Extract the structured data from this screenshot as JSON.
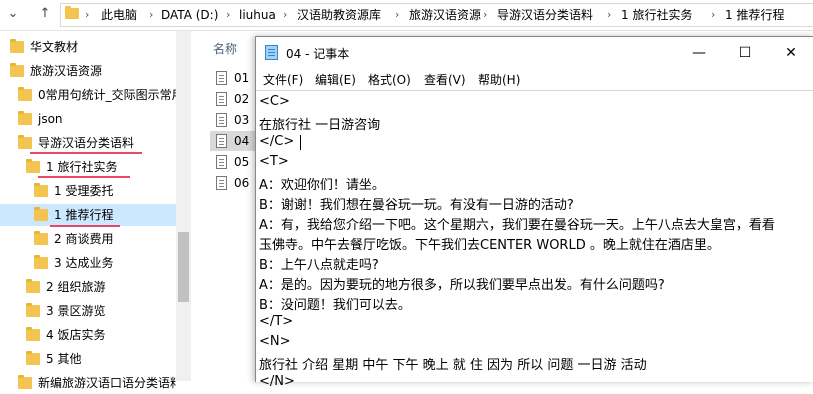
{
  "explorer": {
    "breadcrumbs": [
      "此电脑",
      "DATA (D:)",
      "liuhua",
      "汉语助教资源库",
      "旅游汉语资源",
      "导游汉语分类语料",
      "1 旅行社实务",
      "1 推荐行程"
    ],
    "column_header": "名称",
    "tree": [
      {
        "label": "华文教材"
      },
      {
        "label": "旅游汉语资源"
      },
      {
        "label": "0常用句统计_交际图示常用"
      },
      {
        "label": "json"
      },
      {
        "label": "导游汉语分类语料"
      },
      {
        "label": "1 旅行社实务"
      },
      {
        "label": "1 受理委托"
      },
      {
        "label": "1 推荐行程"
      },
      {
        "label": "2 商谈费用"
      },
      {
        "label": "3 达成业务"
      },
      {
        "label": "2 组织旅游"
      },
      {
        "label": "3 景区游览"
      },
      {
        "label": "4 饭店实务"
      },
      {
        "label": "5 其他"
      },
      {
        "label": "新编旅游汉语口语分类语料"
      }
    ],
    "files": [
      "01",
      "02",
      "03",
      "04",
      "05",
      "06"
    ]
  },
  "notepad": {
    "title": "04 - 记事本",
    "menu": [
      "文件(F)",
      "编辑(E)",
      "格式(O)",
      "查看(V)",
      "帮助(H)"
    ],
    "lines": [
      "<C>",
      "在旅行社 一日游咨询",
      "</C>",
      "<T>",
      "A：欢迎你们！请坐。",
      "B：谢谢！我们想在曼谷玩一玩。有没有一日游的活动?",
      "A：有，我给您介绍一下吧。这个星期六，我们要在曼谷玩一天。上午八点去大皇宫，看看",
      "玉佛寺。中午去餐厅吃饭。下午我们去CENTER WORLD 。晚上就住在酒店里。",
      "B：上午八点就走吗?",
      "A：是的。因为要玩的地方很多，所以我们要早点出发。有什么问题吗?",
      "B：没问题！我们可以去。",
      "</T>",
      "<N>",
      "旅行社 介绍 星期 中午 下午 晚上 就 住 因为 所以 问题 一日游 活动",
      "</N>"
    ]
  },
  "colors": {
    "highlight": "#e8496a",
    "selected": "#cce8ff",
    "folder": "#f3c44f"
  }
}
